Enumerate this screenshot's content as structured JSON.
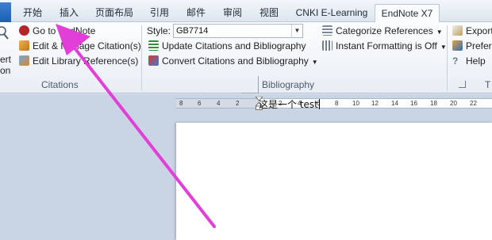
{
  "tabs": {
    "items": [
      "开始",
      "插入",
      "页面布局",
      "引用",
      "邮件",
      "审阅",
      "视图",
      "CNKI E-Learning",
      "EndNote X7"
    ],
    "active": "EndNote X7"
  },
  "citations": {
    "insert_label_1": "ert",
    "insert_label_2": "on",
    "go_to_endnote": "Go to EndNote",
    "edit_manage": "Edit & Manage Citation(s)",
    "edit_library": "Edit Library Reference(s)",
    "group_label": "Citations"
  },
  "bibliography": {
    "style_label": "Style:",
    "style_value": "GB7714",
    "update": "Update Citations and Bibliography",
    "convert": "Convert Citations and Bibliography",
    "categorize": "Categorize References",
    "instant_formatting": "Instant Formatting is Off",
    "group_label": "Bibliography"
  },
  "tools": {
    "export": "Export",
    "preferences": "Prefere",
    "help": "Help",
    "group_label": "T"
  },
  "ruler": {
    "ticks": [
      "8",
      "6",
      "4",
      "2",
      "2",
      "4",
      "6",
      "8",
      "10",
      "12",
      "14",
      "16",
      "18",
      "20",
      "22"
    ]
  },
  "document": {
    "text": "这是一个 test"
  },
  "colors": {
    "accent_blue": "#2a64b8",
    "annotation_arrow": "#e23fd8"
  }
}
